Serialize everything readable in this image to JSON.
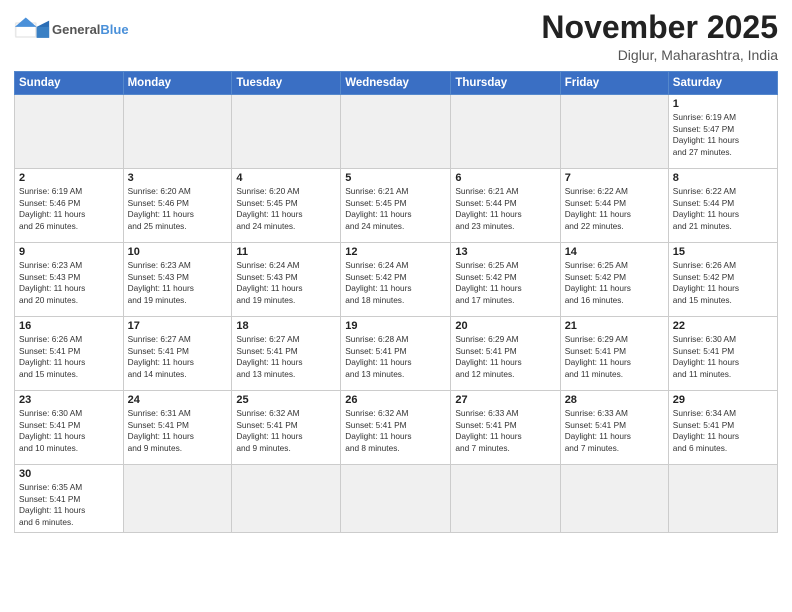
{
  "header": {
    "logo_general": "General",
    "logo_blue": "Blue",
    "month": "November 2025",
    "location": "Diglur, Maharashtra, India"
  },
  "weekdays": [
    "Sunday",
    "Monday",
    "Tuesday",
    "Wednesday",
    "Thursday",
    "Friday",
    "Saturday"
  ],
  "weeks": [
    [
      {
        "day": "",
        "info": "",
        "empty": true
      },
      {
        "day": "",
        "info": "",
        "empty": true
      },
      {
        "day": "",
        "info": "",
        "empty": true
      },
      {
        "day": "",
        "info": "",
        "empty": true
      },
      {
        "day": "",
        "info": "",
        "empty": true
      },
      {
        "day": "",
        "info": "",
        "empty": true
      },
      {
        "day": "1",
        "info": "Sunrise: 6:19 AM\nSunset: 5:47 PM\nDaylight: 11 hours\nand 27 minutes."
      }
    ],
    [
      {
        "day": "2",
        "info": "Sunrise: 6:19 AM\nSunset: 5:46 PM\nDaylight: 11 hours\nand 26 minutes."
      },
      {
        "day": "3",
        "info": "Sunrise: 6:20 AM\nSunset: 5:46 PM\nDaylight: 11 hours\nand 25 minutes."
      },
      {
        "day": "4",
        "info": "Sunrise: 6:20 AM\nSunset: 5:45 PM\nDaylight: 11 hours\nand 24 minutes."
      },
      {
        "day": "5",
        "info": "Sunrise: 6:21 AM\nSunset: 5:45 PM\nDaylight: 11 hours\nand 24 minutes."
      },
      {
        "day": "6",
        "info": "Sunrise: 6:21 AM\nSunset: 5:44 PM\nDaylight: 11 hours\nand 23 minutes."
      },
      {
        "day": "7",
        "info": "Sunrise: 6:22 AM\nSunset: 5:44 PM\nDaylight: 11 hours\nand 22 minutes."
      },
      {
        "day": "8",
        "info": "Sunrise: 6:22 AM\nSunset: 5:44 PM\nDaylight: 11 hours\nand 21 minutes."
      }
    ],
    [
      {
        "day": "9",
        "info": "Sunrise: 6:23 AM\nSunset: 5:43 PM\nDaylight: 11 hours\nand 20 minutes."
      },
      {
        "day": "10",
        "info": "Sunrise: 6:23 AM\nSunset: 5:43 PM\nDaylight: 11 hours\nand 19 minutes."
      },
      {
        "day": "11",
        "info": "Sunrise: 6:24 AM\nSunset: 5:43 PM\nDaylight: 11 hours\nand 19 minutes."
      },
      {
        "day": "12",
        "info": "Sunrise: 6:24 AM\nSunset: 5:42 PM\nDaylight: 11 hours\nand 18 minutes."
      },
      {
        "day": "13",
        "info": "Sunrise: 6:25 AM\nSunset: 5:42 PM\nDaylight: 11 hours\nand 17 minutes."
      },
      {
        "day": "14",
        "info": "Sunrise: 6:25 AM\nSunset: 5:42 PM\nDaylight: 11 hours\nand 16 minutes."
      },
      {
        "day": "15",
        "info": "Sunrise: 6:26 AM\nSunset: 5:42 PM\nDaylight: 11 hours\nand 15 minutes."
      }
    ],
    [
      {
        "day": "16",
        "info": "Sunrise: 6:26 AM\nSunset: 5:41 PM\nDaylight: 11 hours\nand 15 minutes."
      },
      {
        "day": "17",
        "info": "Sunrise: 6:27 AM\nSunset: 5:41 PM\nDaylight: 11 hours\nand 14 minutes."
      },
      {
        "day": "18",
        "info": "Sunrise: 6:27 AM\nSunset: 5:41 PM\nDaylight: 11 hours\nand 13 minutes."
      },
      {
        "day": "19",
        "info": "Sunrise: 6:28 AM\nSunset: 5:41 PM\nDaylight: 11 hours\nand 13 minutes."
      },
      {
        "day": "20",
        "info": "Sunrise: 6:29 AM\nSunset: 5:41 PM\nDaylight: 11 hours\nand 12 minutes."
      },
      {
        "day": "21",
        "info": "Sunrise: 6:29 AM\nSunset: 5:41 PM\nDaylight: 11 hours\nand 11 minutes."
      },
      {
        "day": "22",
        "info": "Sunrise: 6:30 AM\nSunset: 5:41 PM\nDaylight: 11 hours\nand 11 minutes."
      }
    ],
    [
      {
        "day": "23",
        "info": "Sunrise: 6:30 AM\nSunset: 5:41 PM\nDaylight: 11 hours\nand 10 minutes."
      },
      {
        "day": "24",
        "info": "Sunrise: 6:31 AM\nSunset: 5:41 PM\nDaylight: 11 hours\nand 9 minutes."
      },
      {
        "day": "25",
        "info": "Sunrise: 6:32 AM\nSunset: 5:41 PM\nDaylight: 11 hours\nand 9 minutes."
      },
      {
        "day": "26",
        "info": "Sunrise: 6:32 AM\nSunset: 5:41 PM\nDaylight: 11 hours\nand 8 minutes."
      },
      {
        "day": "27",
        "info": "Sunrise: 6:33 AM\nSunset: 5:41 PM\nDaylight: 11 hours\nand 7 minutes."
      },
      {
        "day": "28",
        "info": "Sunrise: 6:33 AM\nSunset: 5:41 PM\nDaylight: 11 hours\nand 7 minutes."
      },
      {
        "day": "29",
        "info": "Sunrise: 6:34 AM\nSunset: 5:41 PM\nDaylight: 11 hours\nand 6 minutes."
      }
    ],
    [
      {
        "day": "30",
        "info": "Sunrise: 6:35 AM\nSunset: 5:41 PM\nDaylight: 11 hours\nand 6 minutes.",
        "last": true
      },
      {
        "day": "",
        "info": "",
        "empty": true,
        "last": true
      },
      {
        "day": "",
        "info": "",
        "empty": true,
        "last": true
      },
      {
        "day": "",
        "info": "",
        "empty": true,
        "last": true
      },
      {
        "day": "",
        "info": "",
        "empty": true,
        "last": true
      },
      {
        "day": "",
        "info": "",
        "empty": true,
        "last": true
      },
      {
        "day": "",
        "info": "",
        "empty": true,
        "last": true
      }
    ]
  ]
}
